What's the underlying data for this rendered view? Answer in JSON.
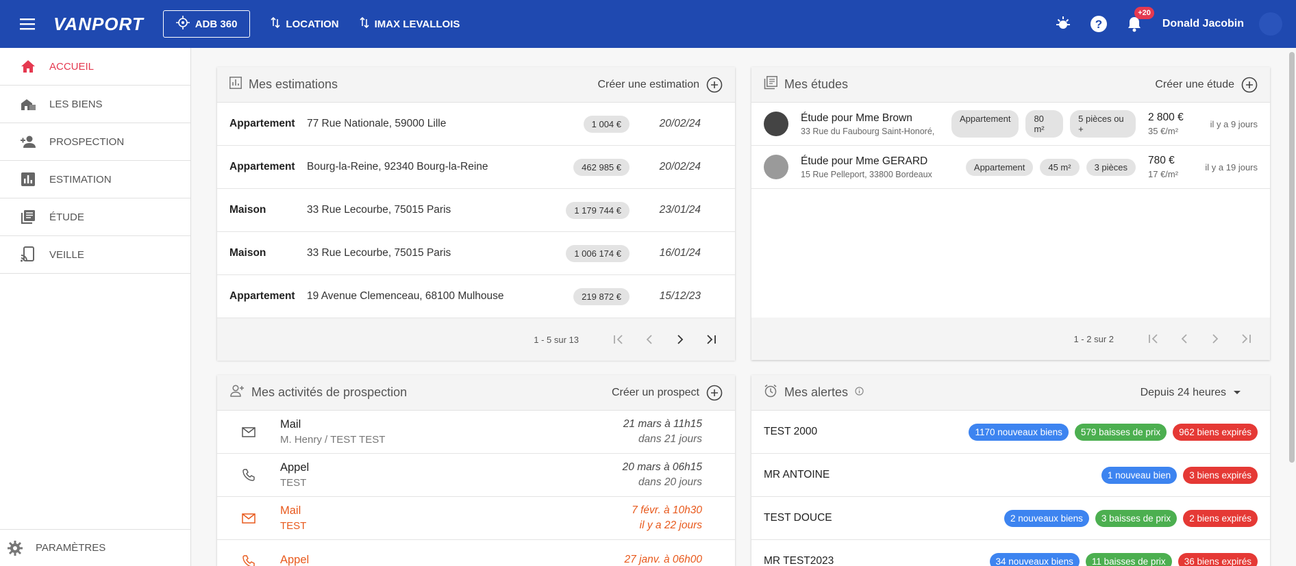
{
  "topbar": {
    "logo": "VANPORT",
    "adb_label": "ADB 360",
    "location_label": "LOCATION",
    "imax_label": "IMAX LEVALLOIS",
    "notif_count": "+20",
    "user_name": "Donald Jacobin"
  },
  "sidebar": {
    "items": [
      {
        "label": "ACCUEIL"
      },
      {
        "label": "LES BIENS"
      },
      {
        "label": "PROSPECTION"
      },
      {
        "label": "ESTIMATION"
      },
      {
        "label": "ÉTUDE"
      },
      {
        "label": "VEILLE"
      }
    ],
    "settings_label": "PARAMÈTRES"
  },
  "estimations": {
    "title": "Mes estimations",
    "action": "Créer une estimation",
    "rows": [
      {
        "type": "Appartement",
        "address": "77 Rue Nationale, 59000 Lille",
        "price": "1 004 €",
        "date": "20/02/24"
      },
      {
        "type": "Appartement",
        "address": "Bourg-la-Reine, 92340 Bourg-la-Reine",
        "price": "462 985 €",
        "date": "20/02/24"
      },
      {
        "type": "Maison",
        "address": "33 Rue Lecourbe, 75015 Paris",
        "price": "1 179 744 €",
        "date": "23/01/24"
      },
      {
        "type": "Maison",
        "address": "33 Rue Lecourbe, 75015 Paris",
        "price": "1 006 174 €",
        "date": "16/01/24"
      },
      {
        "type": "Appartement",
        "address": "19 Avenue Clemenceau, 68100 Mulhouse",
        "price": "219 872 €",
        "date": "15/12/23"
      }
    ],
    "pagination": "1 - 5 sur 13"
  },
  "etudes": {
    "title": "Mes études",
    "action": "Créer une étude",
    "rows": [
      {
        "title": "Étude pour Mme Brown",
        "address": "33 Rue du Faubourg Saint-Honoré,",
        "chip1": "Appartement",
        "chip2": "80 m²",
        "chip3": "5 pièces ou +",
        "price": "2 800 €",
        "price_m2": "35 €/m²",
        "ago": "il y a 9 jours"
      },
      {
        "title": "Étude pour Mme GERARD",
        "address": "15 Rue Pelleport, 33800 Bordeaux",
        "chip1": "Appartement",
        "chip2": "45 m²",
        "chip3": "3 pièces",
        "price": "780 €",
        "price_m2": "17 €/m²",
        "ago": "il y a 19 jours"
      }
    ],
    "pagination": "1 - 2 sur 2"
  },
  "prospection": {
    "title": "Mes activités de prospection",
    "action": "Créer un prospect",
    "rows": [
      {
        "type": "Mail",
        "sub": "M. Henry / TEST TEST",
        "when": "21 mars à 11h15",
        "rel": "dans 21 jours"
      },
      {
        "type": "Appel",
        "sub": "TEST",
        "when": "20 mars à 06h15",
        "rel": "dans 20 jours"
      },
      {
        "type": "Mail",
        "sub": "TEST",
        "when": "7 févr. à 10h30",
        "rel": "il y a 22 jours"
      },
      {
        "type": "Appel",
        "sub": "",
        "when": "27 janv. à 06h00",
        "rel": ""
      }
    ]
  },
  "alertes": {
    "title": "Mes alertes",
    "filter": "Depuis 24 heures",
    "rows": [
      {
        "name": "TEST 2000",
        "new": "1170 nouveaux biens",
        "drops": "579 baisses de prix",
        "expired": "962 biens expirés"
      },
      {
        "name": "MR ANTOINE",
        "new": "1 nouveau bien",
        "drops": "",
        "expired": "3 biens expirés"
      },
      {
        "name": "TEST DOUCE",
        "new": "2 nouveaux biens",
        "drops": "3 baisses de prix",
        "expired": "2 biens expirés"
      },
      {
        "name": "MR TEST2023",
        "new": "34 nouveaux biens",
        "drops": "11 baisses de prix",
        "expired": "36 biens expirés"
      }
    ]
  },
  "colors": {
    "primary": "#1f49b0",
    "accent": "#e53950",
    "late": "#e8591c",
    "pill_blue": "#3d84f0",
    "pill_green": "#4caf50",
    "pill_red": "#e53935"
  }
}
